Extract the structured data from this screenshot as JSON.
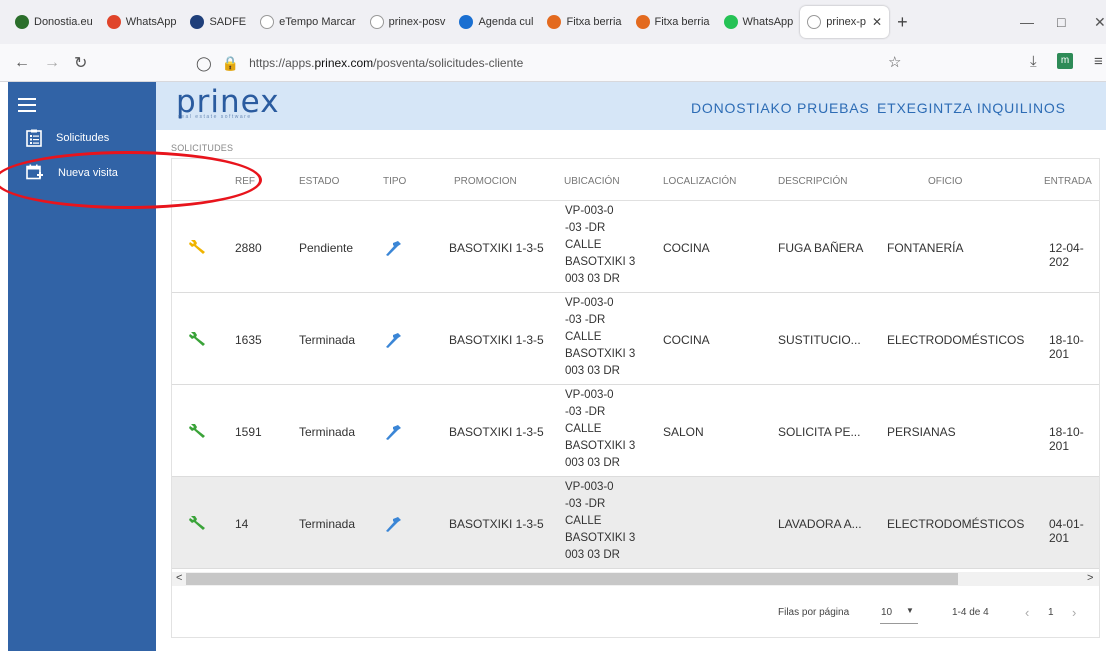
{
  "browser": {
    "tabs": [
      {
        "label": "Donostia.eu",
        "color": "#2b6e2b"
      },
      {
        "label": "WhatsApp",
        "color": "#e0442a"
      },
      {
        "label": "SADFE",
        "color": "#1f3f7a"
      },
      {
        "label": "eTempo Marcar",
        "color": "#ffffff"
      },
      {
        "label": "prinex-posv",
        "color": "#ffffff"
      },
      {
        "label": "Agenda cul",
        "color": "#1a6fd1"
      },
      {
        "label": "Fitxa berria",
        "color": "#e36a1f"
      },
      {
        "label": "Fitxa berria",
        "color": "#e36a1f"
      },
      {
        "label": "WhatsApp",
        "color": "#25c255"
      },
      {
        "label": "prinex-p",
        "color": "#ffffff",
        "active": true
      }
    ],
    "new_tab": "+",
    "url_prefix": "https://apps.",
    "url_host": "prinex.com",
    "url_path": "/posventa/solicitudes-cliente"
  },
  "app": {
    "logo_text": "prinex",
    "logo_sub": "real estate software",
    "header_links": [
      "DONOSTIAKO PRUEBAS",
      "ETXEGINTZA INQUILINOS"
    ],
    "sidebar": {
      "items": [
        {
          "label": "Solicitudes",
          "icon": "clipboard-list-icon"
        },
        {
          "label": "Nueva visita",
          "icon": "calendar-plus-icon"
        }
      ]
    },
    "section_label": "SOLICITUDES",
    "table": {
      "headers": [
        "REF",
        "ESTADO",
        "TIPO",
        "PROMOCION",
        "UBICACIÓN",
        "LOCALIZACIÓN",
        "DESCRIPCIÓN",
        "OFICIO",
        "ENTRADA"
      ],
      "rows": [
        {
          "icon_color": "#f0b400",
          "ref": "2880",
          "estado": "Pendiente",
          "promocion": "BASOTXIKI 1-3-5",
          "ubicacion": [
            "VP-003-0",
            "-03 -DR",
            "CALLE",
            "BASOTXIKI 3",
            "003  03 DR"
          ],
          "localizacion": "COCINA",
          "descripcion": "FUGA BAÑERA",
          "oficio": "FONTANERÍA",
          "entrada": "12-04-202"
        },
        {
          "icon_color": "#3aa339",
          "ref": "1635",
          "estado": "Terminada",
          "promocion": "BASOTXIKI 1-3-5",
          "ubicacion": [
            "VP-003-0",
            "-03 -DR",
            "CALLE",
            "BASOTXIKI 3",
            "003  03 DR"
          ],
          "localizacion": "COCINA",
          "descripcion": "SUSTITUCIO...",
          "oficio": "ELECTRODOMÉSTICOS",
          "entrada": "18-10-201"
        },
        {
          "icon_color": "#3aa339",
          "ref": "1591",
          "estado": "Terminada",
          "promocion": "BASOTXIKI 1-3-5",
          "ubicacion": [
            "VP-003-0",
            "-03 -DR",
            "CALLE",
            "BASOTXIKI 3",
            "003  03 DR"
          ],
          "localizacion": "SALON",
          "descripcion": "SOLICITA PE...",
          "oficio": "PERSIANAS",
          "entrada": "18-10-201"
        },
        {
          "icon_color": "#3aa339",
          "ref": "14",
          "estado": "Terminada",
          "promocion": "BASOTXIKI 1-3-5",
          "ubicacion": [
            "VP-003-0",
            "-03 -DR",
            "CALLE",
            "BASOTXIKI 3",
            "003  03 DR"
          ],
          "localizacion": "",
          "descripcion": "LAVADORA A...",
          "oficio": "ELECTRODOMÉSTICOS",
          "entrada": "04-01-201"
        }
      ]
    },
    "pagination": {
      "rows_per_page_label": "Filas por página",
      "rows_per_page_value": "10",
      "range": "1-4 de 4",
      "page": "1"
    },
    "colors": {
      "sidebar": "#3163a6",
      "header": "#d6e6f7",
      "accent_link": "#2d6cb5",
      "annotation": "#e8141c"
    }
  }
}
